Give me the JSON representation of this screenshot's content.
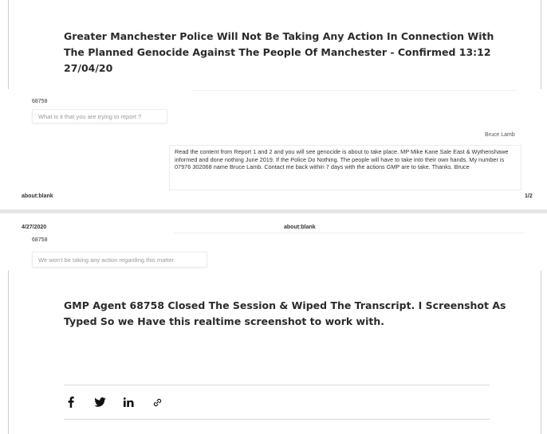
{
  "article": {
    "headline_top": "Greater Manchester Police Will Not Be Taking Any Action In Connection With The Planned Genocide Against The People Of Manchester - Confirmed 13:12 27/04/20",
    "headline_bottom": "GMP Agent 68758 Closed The Session & Wiped The Transcript. I Screenshot As Typed So we Have this realtime screenshot to work with."
  },
  "chat_page1": {
    "agent_id": "68758",
    "question_text": "What is it that you are trying to report ?",
    "user_name": "Bruce Lamb",
    "message": "Read the content from Report 1 and 2 and you will see genocide is about to take place. MP Mike Kane Sale East & Wythenshawe informed and done nothing June 2019. If the Police Do Nothing. The people will have to take into their own hands. My number is 07976 302068 name Bruce Lamb. Contact me back within 7 days with the actions GMP are to take. Thanks. Bruce",
    "footer_left": "about:blank",
    "footer_right": "1/2"
  },
  "chat_page2": {
    "header_date": "4/27/2020",
    "header_center": "about:blank",
    "agent_id": "68758",
    "reply_text": "We won't be taking any action regarding this matter."
  },
  "share": {
    "icons": [
      "facebook-icon",
      "twitter-icon",
      "linkedin-icon",
      "link-icon"
    ]
  }
}
